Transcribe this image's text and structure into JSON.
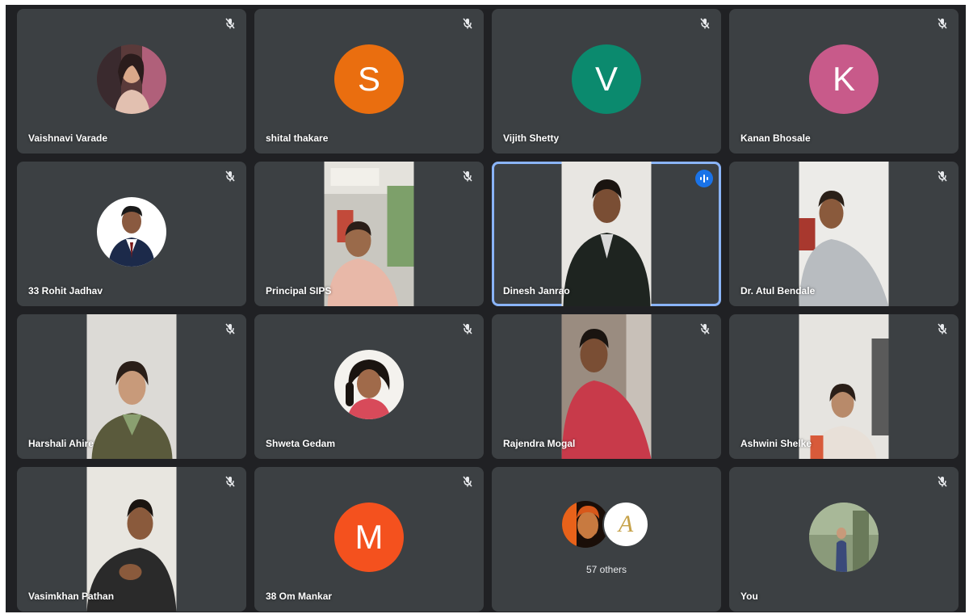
{
  "colors": {
    "background": "#202124",
    "tile": "#3c4043",
    "speaking_border": "#8ab4f8",
    "speaking_indicator": "#1a73e8"
  },
  "tiles": [
    {
      "name": "Vaishnavi Varade",
      "kind": "photo-avatar",
      "muted": true
    },
    {
      "name": "shital thakare",
      "kind": "letter-avatar",
      "letter": "S",
      "color": "#ea6e0f",
      "muted": true
    },
    {
      "name": "Vijith Shetty",
      "kind": "letter-avatar",
      "letter": "V",
      "color": "#0b8a6e",
      "muted": true
    },
    {
      "name": "Kanan Bhosale",
      "kind": "letter-avatar",
      "letter": "K",
      "color": "#c85a8a",
      "muted": true
    },
    {
      "name": "33 Rohit Jadhav",
      "kind": "photo-avatar",
      "muted": true
    },
    {
      "name": "Principal SIPS",
      "kind": "video",
      "muted": true
    },
    {
      "name": "Dinesh Janrao",
      "kind": "video",
      "muted": false,
      "speaking": true
    },
    {
      "name": "Dr. Atul Bendale",
      "kind": "video",
      "muted": true
    },
    {
      "name": "Harshali Ahire",
      "kind": "video",
      "muted": true
    },
    {
      "name": "Shweta Gedam",
      "kind": "photo-avatar",
      "muted": true
    },
    {
      "name": "Rajendra Mogal",
      "kind": "video",
      "muted": true
    },
    {
      "name": "Ashwini Shelke",
      "kind": "video",
      "muted": true
    },
    {
      "name": "Vasimkhan Pathan",
      "kind": "video",
      "muted": true
    },
    {
      "name": "38 Om Mankar",
      "kind": "letter-avatar",
      "letter": "M",
      "color": "#f4511e",
      "muted": true
    },
    {
      "name": "",
      "kind": "others",
      "others_label": "57 others",
      "muted": false
    },
    {
      "name": "You",
      "kind": "photo-avatar",
      "muted": true
    }
  ]
}
